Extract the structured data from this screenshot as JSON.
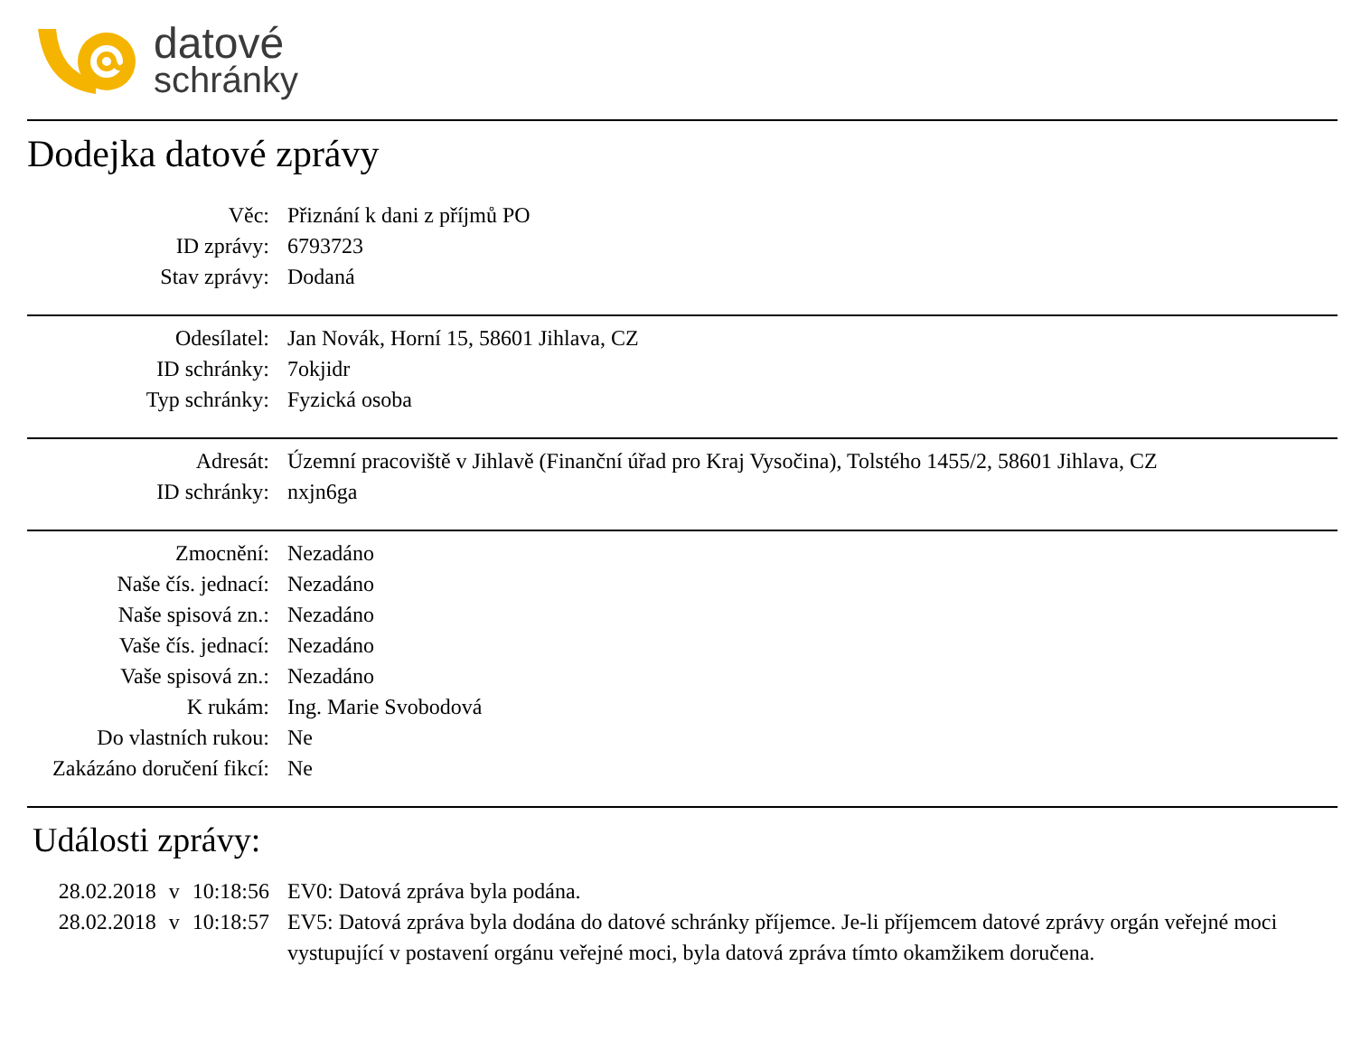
{
  "logo": {
    "line_1": "datové",
    "line_2": "schránky"
  },
  "title": "Dodejka datové zprávy",
  "sections": [
    {
      "rows": [
        {
          "label": "Věc:",
          "value": "Přiznání k dani z příjmů PO"
        },
        {
          "label": "ID zprávy:",
          "value": "6793723"
        },
        {
          "label": "Stav zprávy:",
          "value": "Dodaná"
        }
      ]
    },
    {
      "rows": [
        {
          "label": "Odesílatel:",
          "value": "Jan Novák, Horní 15, 58601 Jihlava, CZ"
        },
        {
          "label": "ID schránky:",
          "value": "7okjidr"
        },
        {
          "label": "Typ schránky:",
          "value": "Fyzická osoba"
        }
      ]
    },
    {
      "rows": [
        {
          "label": "Adresát:",
          "value": "Územní pracoviště v Jihlavě (Finanční úřad pro Kraj Vysočina), Tolstého 1455/2, 58601 Jihlava, CZ"
        },
        {
          "label": "ID schránky:",
          "value": "nxjn6ga"
        }
      ]
    },
    {
      "rows": [
        {
          "label": "Zmocnění:",
          "value": "Nezadáno"
        },
        {
          "label": "Naše čís. jednací:",
          "value": "Nezadáno"
        },
        {
          "label": "Naše spisová zn.:",
          "value": "Nezadáno"
        },
        {
          "label": "Vaše čís. jednací:",
          "value": "Nezadáno"
        },
        {
          "label": "Vaše spisová zn.:",
          "value": "Nezadáno"
        },
        {
          "label": "K rukám:",
          "value": "Ing. Marie Svobodová"
        },
        {
          "label": "Do vlastních rukou:",
          "value": "Ne"
        },
        {
          "label": "Zakázáno doručení fikcí:",
          "value": "Ne"
        }
      ]
    }
  ],
  "events_title": "Události zprávy:",
  "events": [
    {
      "date": "28.02.2018",
      "time": "v 10:18:56",
      "text": "EV0: Datová zpráva byla podána."
    },
    {
      "date": "28.02.2018",
      "time": "v 10:18:57",
      "text": "EV5: Datová zpráva byla dodána do datové schránky příjemce. Je-li příjemcem datové zprávy orgán veřejné moci vystupující v postavení orgánu veřejné moci, byla datová zpráva tímto okamžikem doručena."
    }
  ]
}
